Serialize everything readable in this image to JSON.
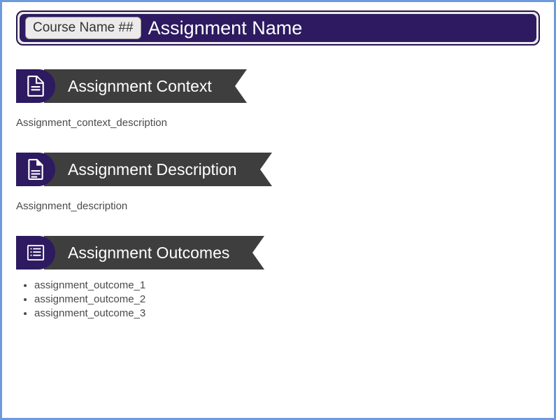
{
  "header": {
    "course_badge": "Course Name ##",
    "assignment_title": "Assignment Name"
  },
  "sections": {
    "context": {
      "heading": "Assignment Context",
      "body": "Assignment_context_description",
      "icon": "document-icon"
    },
    "description": {
      "heading": "Assignment Description",
      "body": "Assignment_description",
      "icon": "document-fold-icon"
    },
    "outcomes": {
      "heading": "Assignment Outcomes",
      "icon": "list-icon",
      "items": [
        "assignment_outcome_1",
        "assignment_outcome_2",
        "assignment_outcome_3"
      ]
    }
  },
  "colors": {
    "primary_dark": "#2d1a60",
    "ribbon_gray": "#3e3e3e",
    "frame_blue": "#6f9adf"
  }
}
